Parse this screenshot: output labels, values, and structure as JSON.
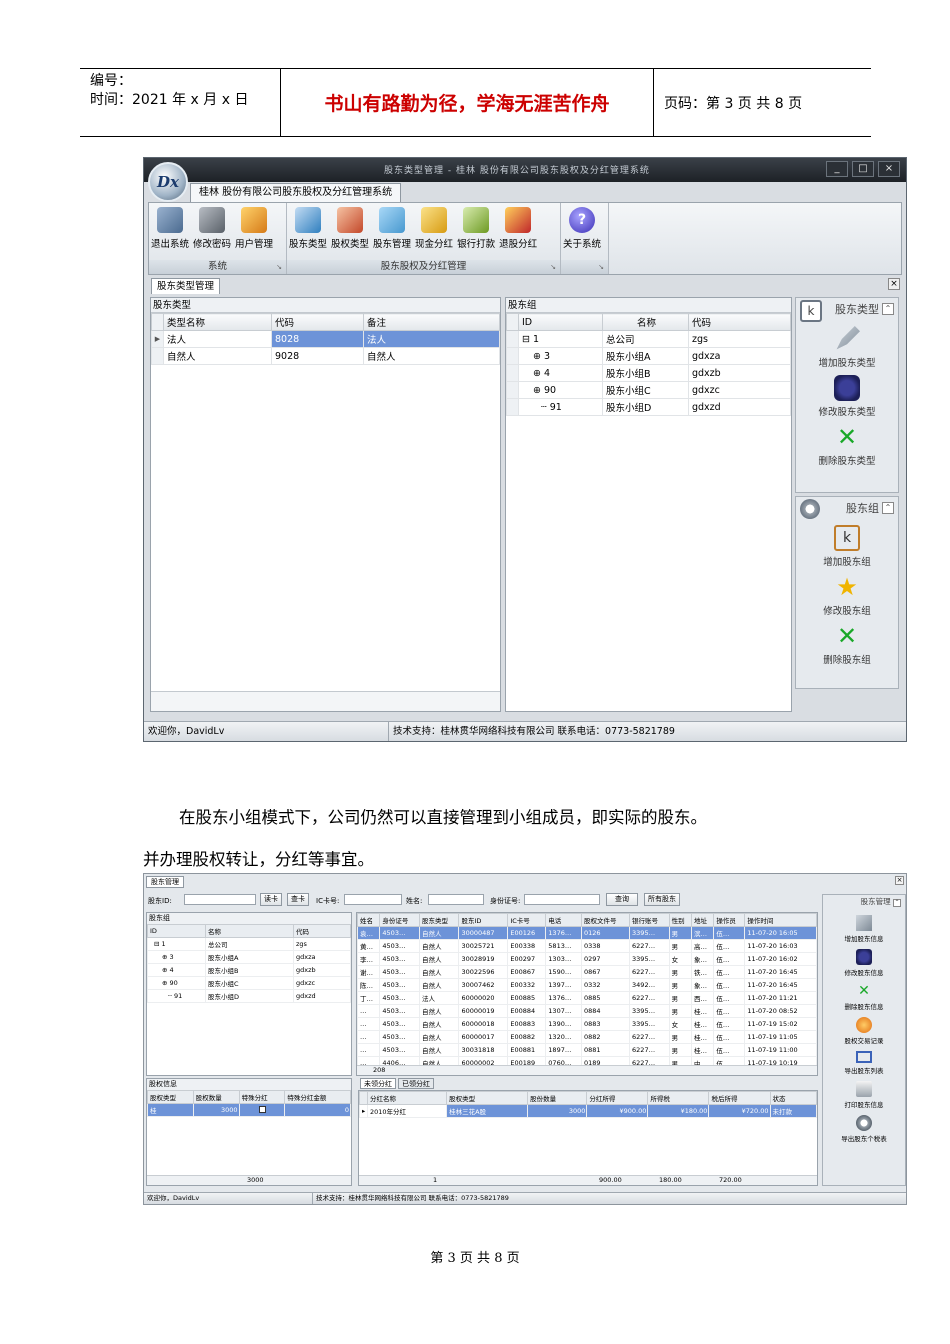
{
  "header": {
    "number_label": "编号：",
    "time_label": "时间：2021 年 x 月 x 日",
    "motto": "书山有路勤为径，学海无涯苦作舟",
    "page_label": "页码：第 3 页 共 8 页"
  },
  "window1": {
    "app_logo": "Dx",
    "title": "股东类型管理 - 桂林 股份有限公司股东股权及分红管理系统",
    "ribbon_tab": "桂林 股份有限公司股东股权及分红管理系统",
    "win_min": "_",
    "win_max": "□",
    "win_close": "×",
    "groups": [
      {
        "label": "系统",
        "buttons": [
          "退出系统",
          "修改密码",
          "用户管理"
        ]
      },
      {
        "label": "股东股权及分红管理",
        "buttons": [
          "股东类型",
          "股权类型",
          "股东管理",
          "现金分红",
          "银行打款",
          "退股分红"
        ]
      },
      {
        "label": "",
        "buttons": [
          "关于系统"
        ]
      }
    ],
    "doc_tab": "股东类型管理",
    "left_panel": {
      "title": "股东类型",
      "columns": [
        "类型名称",
        "代码",
        "备注"
      ],
      "rows": [
        [
          "法人",
          "8028",
          "法人"
        ],
        [
          "自然人",
          "9028",
          "自然人"
        ]
      ]
    },
    "right_panel": {
      "title": "股东组",
      "columns": [
        "ID",
        "名称",
        "代码"
      ],
      "rows": [
        {
          "id": "1",
          "name": "总公司",
          "code": "zgs",
          "prefix": "⊟"
        },
        {
          "id": "3",
          "name": "股东小组A",
          "code": "gdxza",
          "prefix": "⊕"
        },
        {
          "id": "4",
          "name": "股东小组B",
          "code": "gdxzb",
          "prefix": "⊕"
        },
        {
          "id": "90",
          "name": "股东小组C",
          "code": "gdxzc",
          "prefix": "⊕"
        },
        {
          "id": "91",
          "name": "股东小组D",
          "code": "gdxzd",
          "prefix": "┄"
        }
      ]
    },
    "side_type": {
      "title": "股东类型",
      "items": [
        "增加股东类型",
        "修改股东类型",
        "删除股东类型"
      ]
    },
    "side_group": {
      "title": "股东组",
      "items": [
        "增加股东组",
        "修改股东组",
        "删除股东组"
      ]
    },
    "status_welcome": "欢迎你，DavidLv",
    "status_support": "技术支持：桂林贯华网络科技有限公司 联系电话：0773-5821789"
  },
  "paragraph": {
    "line1": "在股东小组模式下，公司仍然可以直接管理到小组成员，即实际的股东。",
    "line2": "并办理股权转让，分红等事宜。"
  },
  "window2": {
    "tab": "股东管理",
    "search": {
      "id_label": "股东ID:",
      "read_btn": "读卡",
      "check_btn": "查卡",
      "ic_label": "IC卡号:",
      "name_label": "姓名:",
      "idcard_label": "身份证号:",
      "query_btn": "查询",
      "all_btn": "所有股东"
    },
    "group_panel": {
      "title": "股东组",
      "columns": [
        "ID",
        "名称",
        "代码"
      ],
      "rows": [
        [
          "⊟ 1",
          "总公司",
          "zgs"
        ],
        [
          "⊕ 3",
          "股东小组A",
          "gdxza"
        ],
        [
          "⊕ 4",
          "股东小组B",
          "gdxzb"
        ],
        [
          "⊕ 90",
          "股东小组C",
          "gdxzc"
        ],
        [
          "┄ 91",
          "股东小组D",
          "gdxzd"
        ]
      ]
    },
    "member_columns": [
      "姓名",
      "身份证号",
      "股东类型",
      "股东ID",
      "IC卡号",
      "电话",
      "股权文件号",
      "银行账号",
      "性别",
      "地址",
      "操作员",
      "操作时间"
    ],
    "member_rows": [
      [
        "袁…",
        "4503…",
        "自然人",
        "30000487",
        "E00126",
        "1376…",
        "0126",
        "3395…",
        "男",
        "滨…",
        "伍…",
        "11-07-20 16:05"
      ],
      [
        "黄…",
        "4503…",
        "自然人",
        "30025721",
        "E00338",
        "5813…",
        "0338",
        "6227…",
        "男",
        "高…",
        "伍…",
        "11-07-20 16:03"
      ],
      [
        "李…",
        "4503…",
        "自然人",
        "30028919",
        "E00297",
        "1303…",
        "0297",
        "3395…",
        "女",
        "象…",
        "伍…",
        "11-07-20 16:02"
      ],
      [
        "谢…",
        "4503…",
        "自然人",
        "30022596",
        "E00867",
        "1590…",
        "0867",
        "6227…",
        "男",
        "铁…",
        "伍…",
        "11-07-20 16:45"
      ],
      [
        "陈…",
        "4503…",
        "自然人",
        "30007462",
        "E00332",
        "1397…",
        "0332",
        "3492…",
        "男",
        "象…",
        "伍…",
        "11-07-20 16:45"
      ],
      [
        "丁…",
        "4503…",
        "法人",
        "60000020",
        "E00885",
        "1376…",
        "0885",
        "6227…",
        "男",
        "西…",
        "伍…",
        "11-07-20 11:21"
      ],
      [
        "…",
        "4503…",
        "自然人",
        "60000019",
        "E00884",
        "1307…",
        "0884",
        "3395…",
        "男",
        "桂…",
        "伍…",
        "11-07-20 08:52"
      ],
      [
        "…",
        "4503…",
        "自然人",
        "60000018",
        "E00883",
        "1390…",
        "0883",
        "3395…",
        "女",
        "桂…",
        "伍…",
        "11-07-19 15:02"
      ],
      [
        "…",
        "4503…",
        "自然人",
        "60000017",
        "E00882",
        "1320…",
        "0882",
        "6227…",
        "男",
        "桂…",
        "伍…",
        "11-07-19 11:05"
      ],
      [
        "…",
        "4503…",
        "自然人",
        "30031818",
        "E00881",
        "1897…",
        "0881",
        "6227…",
        "男",
        "桂…",
        "伍…",
        "11-07-19 11:00"
      ],
      [
        "…",
        "4406…",
        "自然人",
        "60000002",
        "E00189",
        "0760…",
        "0189",
        "6227…",
        "男",
        "中…",
        "伍…",
        "11-07-19 10:19"
      ]
    ],
    "member_total": "208",
    "share_panel": {
      "title": "股权信息",
      "columns": [
        "股权类型",
        "股权数量",
        "特殊分红",
        "特殊分红金额"
      ],
      "rows": [
        [
          "桂",
          "3000",
          "",
          "0"
        ]
      ],
      "total": "3000"
    },
    "dividend_tabs": [
      "未领分红",
      "已领分红"
    ],
    "dividend_columns": [
      "分红名称",
      "股权类型",
      "股份数量",
      "分红所得",
      "所得税",
      "税后所得",
      "状态"
    ],
    "dividend_rows": [
      [
        "2010年分红",
        "桂林三花A股",
        "3000",
        "¥900.00",
        "¥180.00",
        "¥720.00",
        "未打款"
      ]
    ],
    "dividend_totals": [
      "1",
      "900.00",
      "180.00",
      "720.00"
    ],
    "side": {
      "title": "股东管理",
      "items": [
        "增加股东信息",
        "修改股东信息",
        "删除股东信息",
        "股权交易记录",
        "导出股东列表",
        "打印股东信息",
        "导出股东个税表"
      ]
    },
    "status_welcome": "欢迎你，DavidLv",
    "status_support": "技术支持：桂林贯华网络科技有限公司 联系电话：0773-5821789"
  },
  "footer": "第 3 页 共 8 页"
}
